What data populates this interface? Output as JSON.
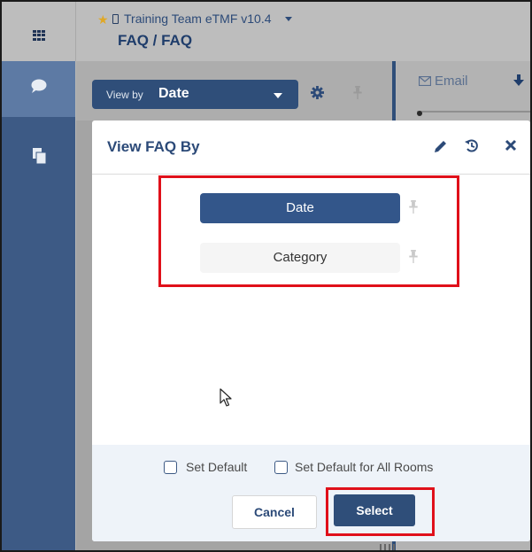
{
  "header": {
    "app_title": "Training Team eTMF v10.4",
    "breadcrumb": "FAQ / FAQ"
  },
  "toolbar": {
    "view_by_label": "View by",
    "view_by_value": "Date"
  },
  "right_panel": {
    "email_label": "Email"
  },
  "modal": {
    "title": "View FAQ By",
    "options": [
      {
        "label": "Date",
        "selected": true
      },
      {
        "label": "Category",
        "selected": false
      }
    ],
    "set_default_label": "Set Default",
    "set_default_all_label": "Set Default for All Rooms",
    "cancel_label": "Cancel",
    "select_label": "Select"
  },
  "colors": {
    "accent": "#2f4e79",
    "highlight": "#e0101a",
    "star": "#e0a826"
  },
  "icons": [
    "grid-icon",
    "chat-icon",
    "documents-icon",
    "star-icon",
    "phone-icon",
    "gear-icon",
    "pin-icon",
    "email-icon",
    "download-icon",
    "pencil-icon",
    "history-icon",
    "close-icon",
    "cursor-icon"
  ]
}
